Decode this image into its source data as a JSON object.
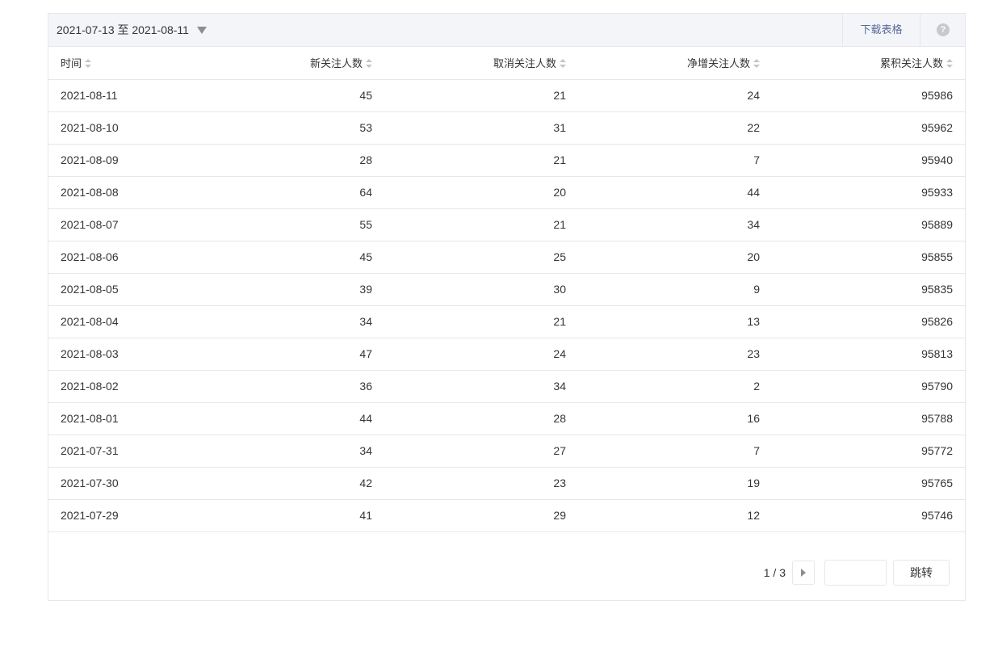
{
  "toolbar": {
    "date_range": "2021-07-13 至 2021-08-11",
    "download_label": "下载表格",
    "help_icon": "question-icon",
    "help_glyph": "?"
  },
  "table": {
    "columns": [
      "时间",
      "新关注人数",
      "取消关注人数",
      "净增关注人数",
      "累积关注人数"
    ],
    "rows": [
      [
        "2021-08-11",
        "45",
        "21",
        "24",
        "95986"
      ],
      [
        "2021-08-10",
        "53",
        "31",
        "22",
        "95962"
      ],
      [
        "2021-08-09",
        "28",
        "21",
        "7",
        "95940"
      ],
      [
        "2021-08-08",
        "64",
        "20",
        "44",
        "95933"
      ],
      [
        "2021-08-07",
        "55",
        "21",
        "34",
        "95889"
      ],
      [
        "2021-08-06",
        "45",
        "25",
        "20",
        "95855"
      ],
      [
        "2021-08-05",
        "39",
        "30",
        "9",
        "95835"
      ],
      [
        "2021-08-04",
        "34",
        "21",
        "13",
        "95826"
      ],
      [
        "2021-08-03",
        "47",
        "24",
        "23",
        "95813"
      ],
      [
        "2021-08-02",
        "36",
        "34",
        "2",
        "95790"
      ],
      [
        "2021-08-01",
        "44",
        "28",
        "16",
        "95788"
      ],
      [
        "2021-07-31",
        "34",
        "27",
        "7",
        "95772"
      ],
      [
        "2021-07-30",
        "42",
        "23",
        "19",
        "95765"
      ],
      [
        "2021-07-29",
        "41",
        "29",
        "12",
        "95746"
      ]
    ]
  },
  "pager": {
    "page_info": "1 / 3",
    "jump_value": "",
    "jump_label": "跳转"
  },
  "colors": {
    "header_bg": "#f4f5f9",
    "border": "#e7e7eb",
    "link": "#576b95",
    "text": "#353535"
  }
}
